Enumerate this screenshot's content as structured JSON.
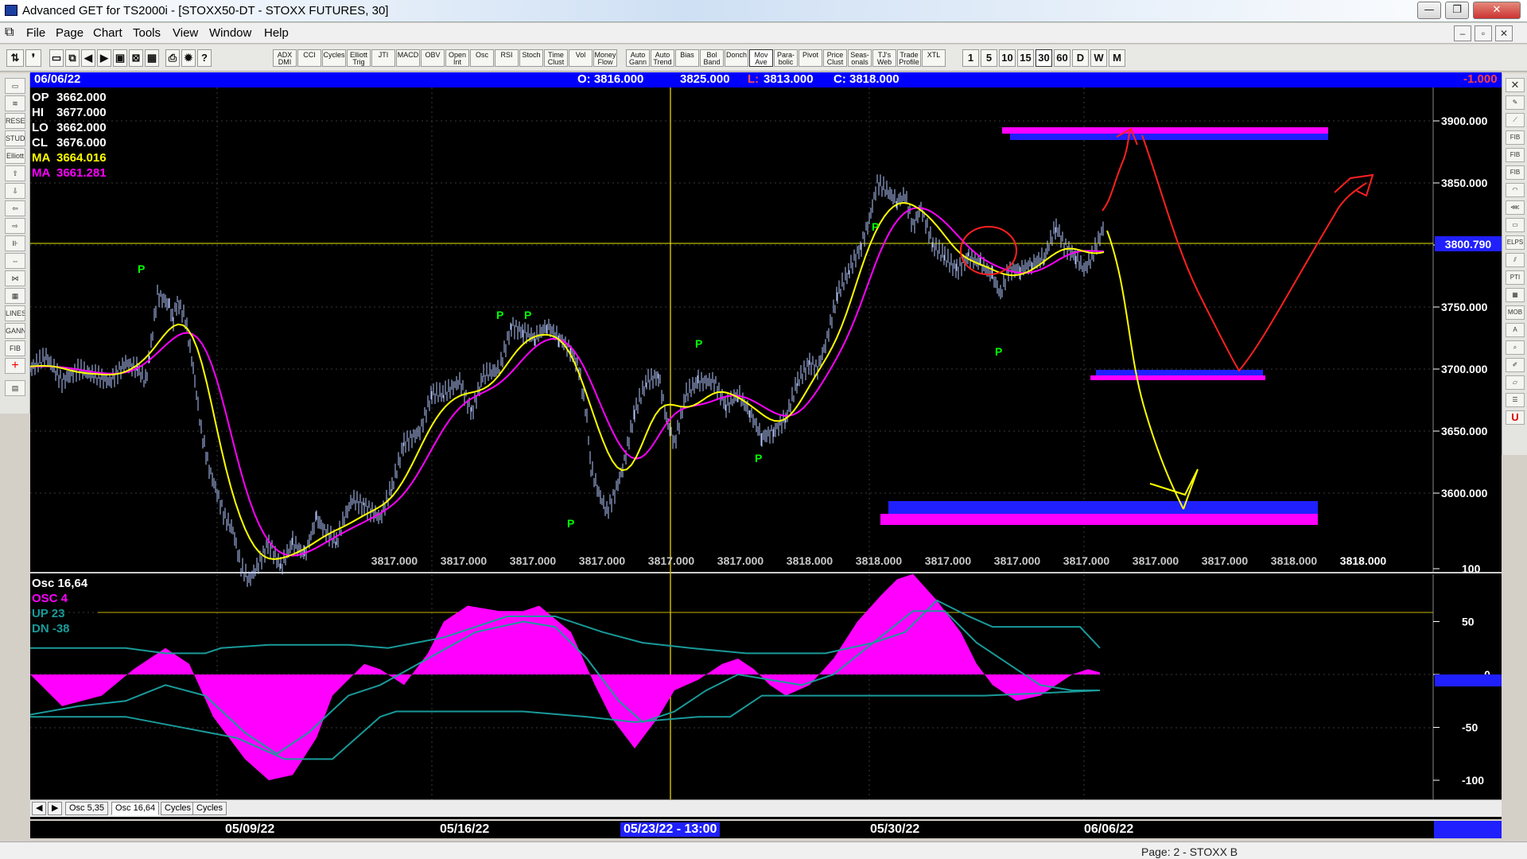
{
  "window": {
    "title": "Advanced GET for TS2000i - [STOXX50-DT - STOXX FUTURES, 30]",
    "min": "—",
    "max": "❐",
    "close": "✕"
  },
  "menu": {
    "items": [
      "File",
      "Page",
      "Chart",
      "Tools",
      "View",
      "Window",
      "Help"
    ],
    "mdi": [
      "–",
      "▫",
      "✕"
    ]
  },
  "toolbar": {
    "indicators": [
      "ADX DMI",
      "CCI",
      "Cycles",
      "Elliott Trig",
      "JTI",
      "MACD",
      "OBV",
      "Open Int",
      "Osc",
      "RSI",
      "Stoch",
      "Time Clust",
      "Vol",
      "Money Flow",
      "Auto Gann",
      "Auto Trend",
      "Bias",
      "Bol Band",
      "Donch",
      "Mov Ave",
      "Para-bolic",
      "Pivot",
      "Price Clust",
      "Seas-onals",
      "TJ's Web",
      "Trade Profile",
      "XTL"
    ],
    "periods": [
      "1",
      "5",
      "10",
      "15",
      "30",
      "60",
      "D",
      "W",
      "M"
    ],
    "selected_period": "30"
  },
  "infobar": {
    "date": "06/06/22",
    "open": "O: 3816.000",
    "high": "3825.000",
    "low_label": "L:",
    "low": "3813.000",
    "close": "C: 3818.000",
    "change": "-1.000"
  },
  "price_panel": {
    "legend": [
      {
        "label": "OP",
        "value": "3662.000",
        "color": "#ffffff"
      },
      {
        "label": "HI",
        "value": "3677.000",
        "color": "#ffffff"
      },
      {
        "label": "LO",
        "value": "3662.000",
        "color": "#ffffff"
      },
      {
        "label": "CL",
        "value": "3676.000",
        "color": "#ffffff"
      },
      {
        "label": "MA",
        "value": "3664.016",
        "color": "#ffff00"
      },
      {
        "label": "MA",
        "value": "3661.281",
        "color": "#ff00ff"
      }
    ],
    "y_ticks": [
      "3900.000",
      "3850.000",
      "3800.000",
      "3750.000",
      "3700.000",
      "3650.000",
      "3600.000"
    ],
    "current_price": "3800.790",
    "bottom_values": [
      "3817.000",
      "3817.000",
      "3817.000",
      "3817.000",
      "3817.000",
      "3817.000",
      "3818.000",
      "3818.000",
      "3817.000",
      "3817.000",
      "3817.000",
      "3817.000",
      "3817.000",
      "3818.000",
      "3818.000"
    ],
    "pivot_markers": [
      "P",
      "P",
      "P",
      "P",
      "P",
      "P",
      "P",
      "P",
      "P"
    ]
  },
  "osc_panel": {
    "legend": [
      {
        "label": "Osc 16,64",
        "color": "#ffffff"
      },
      {
        "label": "OSC 4",
        "color": "#ff00ff"
      },
      {
        "label": "UP   23",
        "color": "#1a9a9a"
      },
      {
        "label": "DN   -38",
        "color": "#1a9a9a"
      }
    ],
    "y_ticks": [
      "100",
      "50",
      "0",
      "-50",
      "-100"
    ]
  },
  "tabs": [
    "Osc 5,35",
    "Osc 16,64",
    "Cycles",
    "Cycles"
  ],
  "selected_tab": "Osc 16,64",
  "dates": [
    "05/09/22",
    "05/16/22",
    "05/23/22 - 13:00",
    "05/30/22",
    "06/06/22"
  ],
  "status": {
    "page": "Page: 2 - STOXX B"
  },
  "colors": {
    "price_bars": "#b4c8ff",
    "ma_fast": "#ffff00",
    "ma_slow": "#ff00ff",
    "osc": "#ff00ff",
    "bands": "#1a9a9a",
    "pivot": "#00ff00",
    "annotation_red": "#ff2020",
    "annotation_yellow": "#ffff00",
    "zone_blue": "#2020ff",
    "zone_magenta": "#ff00ff"
  }
}
